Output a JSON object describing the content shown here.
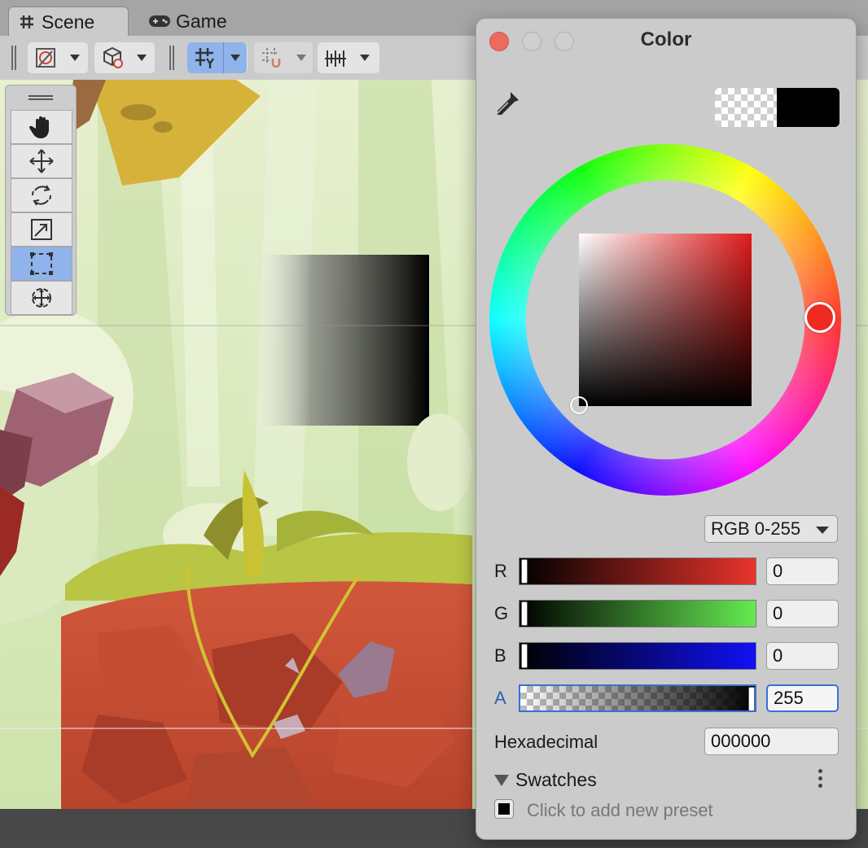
{
  "tabs": [
    {
      "label": "Scene",
      "active": true
    },
    {
      "label": "Game",
      "active": false
    }
  ],
  "color_window": {
    "title": "Color",
    "mode_label": "RGB 0-255",
    "channels": [
      {
        "label": "R",
        "value": "0"
      },
      {
        "label": "G",
        "value": "0"
      },
      {
        "label": "B",
        "value": "0"
      },
      {
        "label": "A",
        "value": "255"
      }
    ],
    "hex_label": "Hexadecimal",
    "hex_value": "000000",
    "swatches_label": "Swatches",
    "preset_text": "Click to add new preset"
  },
  "icons": [
    "grid-icon",
    "gamepad-icon",
    "gizmo-draw-icon",
    "cube-icon",
    "grid-snap-icon",
    "snap-increment-icon",
    "ruler-icon",
    "hand-tool-icon",
    "move-tool-icon",
    "rotate-tool-icon",
    "scale-tool-icon",
    "rect-tool-icon",
    "transform-tool-icon",
    "eyedropper-icon",
    "kebab-menu-icon"
  ],
  "colors": {
    "accent": "#8fb3ea",
    "close": "#ed6a5e",
    "selected_color": "#000000"
  }
}
